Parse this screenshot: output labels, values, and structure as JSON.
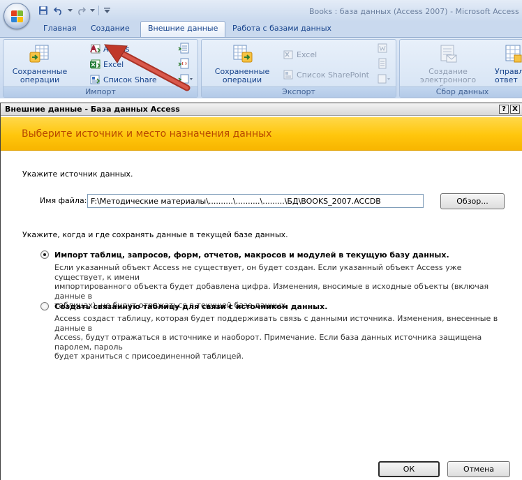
{
  "window": {
    "title": "Books : база данных (Access 2007)  -  Microsoft Access"
  },
  "tabs": [
    {
      "label": "Главная"
    },
    {
      "label": "Создание"
    },
    {
      "label": "Внешние данные"
    },
    {
      "label": "Работа с базами данных"
    }
  ],
  "ribbon": {
    "import_group": {
      "label": "Импорт",
      "saved_imports": "Сохраненные операции импорта",
      "access": "Access",
      "excel": "Excel",
      "sharepoint": "Список Share"
    },
    "export_group": {
      "label": "Экспорт",
      "saved_exports": "Сохраненные операции экспорта",
      "excel": "Excel",
      "sharepoint": "Список SharePoint"
    },
    "collect_group": {
      "label": "Сбор данных",
      "create_email": "Создание электронного сообщения",
      "manage": "Управл ответ"
    }
  },
  "dialog": {
    "title": "Внешние данные - База данных Access",
    "help": "?",
    "close": "X",
    "banner": "Выберите источник и место назначения данных",
    "specify_source": "Укажите источник данных.",
    "file_label": "Имя файла:",
    "file_value": "F:\\Методические материалы\\..........\\..........\\.........\\БД\\BOOKS_2007.ACCDB",
    "browse": "Обзор...",
    "where_to_store": "Укажите, когда и где сохранять данные в текущей базе данных.",
    "option_import": {
      "label": "Импорт таблиц, запросов, форм, отчетов, макросов и модулей в текущую базу данных.",
      "desc1": "Если указанный объект Access не существует, он будет создан. Если указанный объект Access уже существует, к имени",
      "desc2": "импортированного объекта будет добавлена цифра. Изменения, вносимые в исходные объекты (включая данные в",
      "desc3": "таблицах), не будут отражаться в текущей базе данных.",
      "checked": true
    },
    "option_link": {
      "label": "Создать связанную таблицу для связи с источником данных.",
      "desc1": "Access создаст таблицу, которая будет поддерживать связь с данными источника. Изменения, внесенные в данные в",
      "desc2": "Access, будут отражаться в источнике и наоборот. Примечание. Если база данных источника защищена паролем, пароль",
      "desc3": "будет храниться с присоединенной таблицей.",
      "checked": false
    },
    "ok": "ОК",
    "cancel": "Отмена"
  },
  "colors": {
    "ribbon_text": "#15428b",
    "banner_text": "#b84800",
    "banner_bg": "#ffc60c",
    "annotation_arrow": "#c0392b"
  }
}
